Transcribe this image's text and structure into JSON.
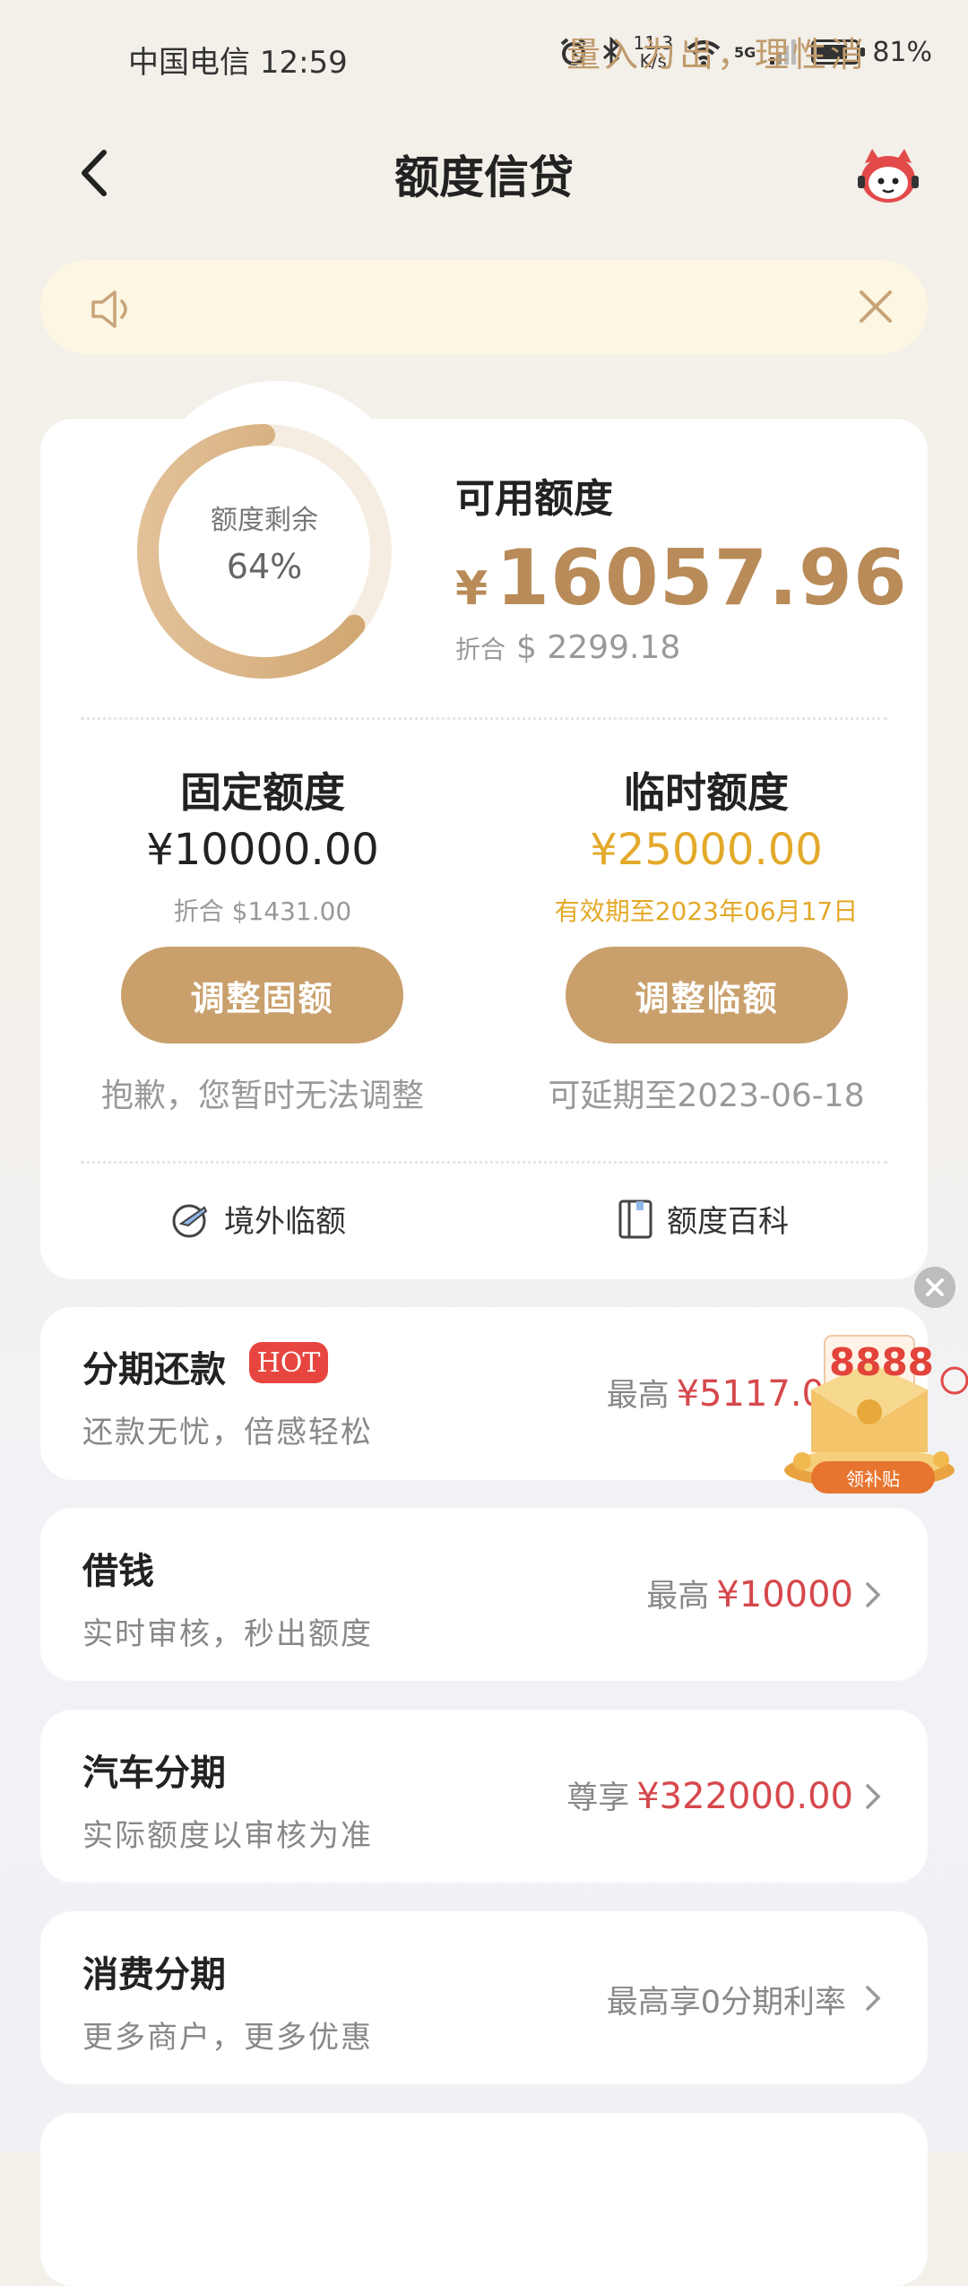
{
  "status_bar": {
    "carrier_time": "中国电信 12:59",
    "net_speed_top": "11.3",
    "net_speed_bottom": "K/s",
    "signal_tag": "5G",
    "battery_text": "81%",
    "battery_level": 0.81
  },
  "header": {
    "title": "额度信贷",
    "back_icon": "chevron-left-icon",
    "service_icon": "mascot-assistant-icon"
  },
  "notice": {
    "text": "量入为出，理性消",
    "speaker_icon": "speaker-icon",
    "close_icon": "close-icon"
  },
  "credit": {
    "ring_label": "额度剩余",
    "ring_percent_text": "64%",
    "ring_fraction": 0.64,
    "available_label": "可用额度",
    "available_currency": "¥",
    "available_amount": "16057.96",
    "available_usd_prefix": "折合",
    "available_usd": "$ 2299.18",
    "fixed": {
      "title": "固定额度",
      "value": "¥10000.00",
      "sub": "折合 $1431.00",
      "button": "调整固额",
      "note": "抱歉，您暂时无法调整"
    },
    "temp": {
      "title": "临时额度",
      "value": "¥25000.00",
      "sub": "有效期至2023年06月17日",
      "button": "调整临额",
      "note": "可延期至2023-06-18"
    },
    "links": [
      {
        "label": "境外临额",
        "icon": "plane-globe-icon"
      },
      {
        "label": "额度百科",
        "icon": "book-icon"
      }
    ]
  },
  "products": [
    {
      "title": "分期还款",
      "badge": "HOT",
      "sub": "还款无忧，倍感轻松",
      "right_prefix": "最高",
      "right_amount": "¥5117.0"
    },
    {
      "title": "借钱",
      "sub": "实时审核，秒出额度",
      "right_prefix": "最高",
      "right_amount": "¥10000"
    },
    {
      "title": "汽车分期",
      "sub": "实际额度以审核为准",
      "right_prefix": "尊享",
      "right_amount": "¥322000.00"
    },
    {
      "title": "消费分期",
      "sub": "更多商户，更多优惠",
      "right_prefix": "最高享0分期利率",
      "right_amount": ""
    }
  ],
  "promo": {
    "number": "8888",
    "button": "领补贴",
    "close_icon": "close-icon"
  },
  "colors": {
    "accent_gold": "#c9a06c",
    "amount_gold": "#b88b58",
    "temp_yellow": "#e3a92a",
    "price_red": "#d6484c",
    "notice_bg": "#fdf6e3"
  }
}
